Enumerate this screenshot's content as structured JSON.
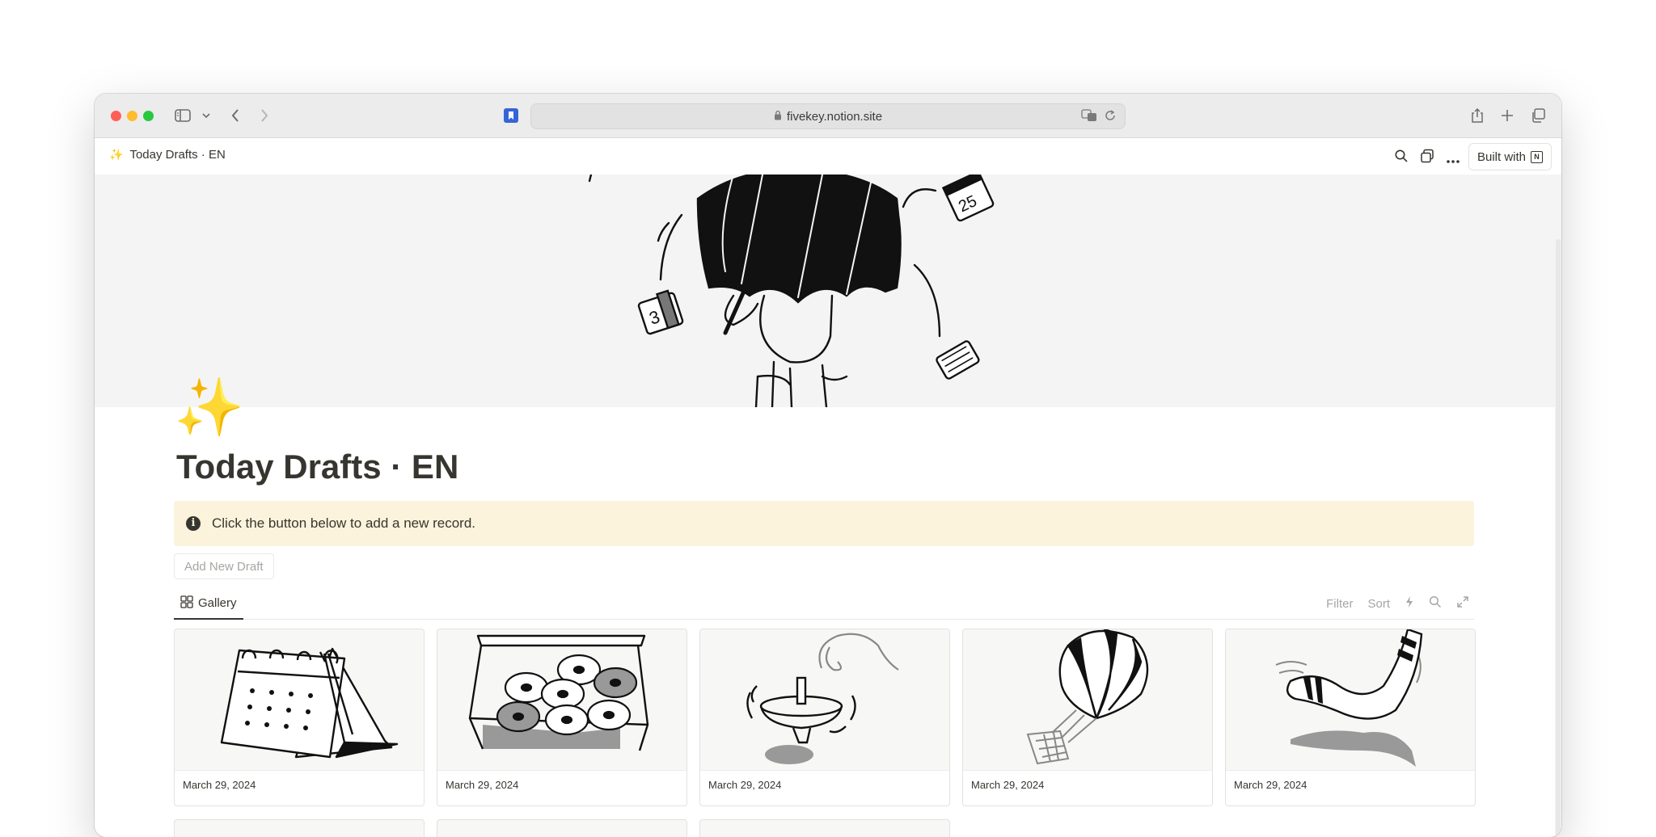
{
  "browser": {
    "url": "fivekey.notion.site"
  },
  "notion": {
    "breadcrumb_icon": "✨",
    "breadcrumb": "Today Drafts · EN",
    "built_with": "Built with",
    "page_icon": "✨",
    "title": "Today Drafts · EN",
    "callout_icon": "i",
    "callout_text": "Click the button below to add a new record.",
    "add_button": "Add New Draft",
    "view_tab": "Gallery",
    "tools": {
      "filter": "Filter",
      "sort": "Sort"
    },
    "cards": [
      {
        "date": "March 29, 2024",
        "illustration": "calendar-illustration"
      },
      {
        "date": "March 29, 2024",
        "illustration": "donut-box-illustration"
      },
      {
        "date": "March 29, 2024",
        "illustration": "spinning-top-illustration"
      },
      {
        "date": "March 29, 2024",
        "illustration": "hot-air-balloon-illustration"
      },
      {
        "date": "March 29, 2024",
        "illustration": "boomerang-illustration"
      }
    ]
  }
}
